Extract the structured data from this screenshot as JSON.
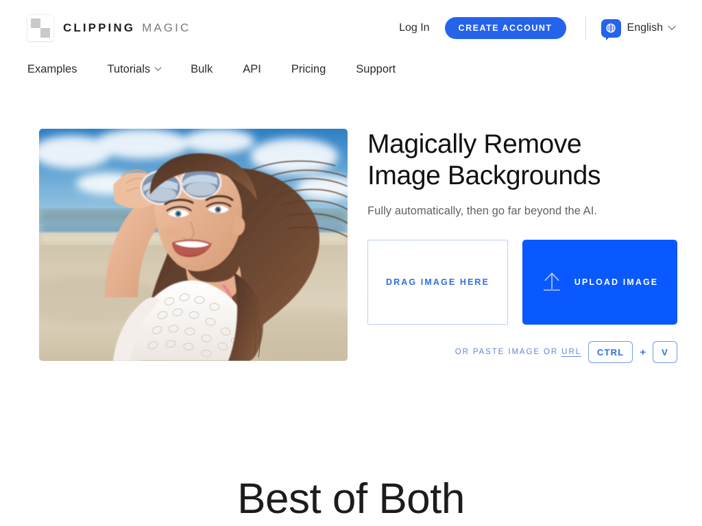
{
  "brand": {
    "word_primary": "CLIPPING",
    "word_secondary": "MAGIC",
    "logo_icon": "checkerboard-transparency-icon"
  },
  "header": {
    "login_label": "Log In",
    "create_account_label": "CREATE ACCOUNT",
    "language_label": "English",
    "language_icon": "globe-speech-bubble-icon",
    "language_chevron_icon": "chevron-down-icon",
    "accent_color": "#2563EB"
  },
  "nav": {
    "items": [
      {
        "label": "Examples",
        "has_dropdown": false
      },
      {
        "label": "Tutorials",
        "has_dropdown": true
      },
      {
        "label": "Bulk",
        "has_dropdown": false
      },
      {
        "label": "API",
        "has_dropdown": false
      },
      {
        "label": "Pricing",
        "has_dropdown": false
      },
      {
        "label": "Support",
        "has_dropdown": false
      }
    ]
  },
  "hero": {
    "photo_alt": "Smiling woman on a sunny beach holding mirrored sunglasses up on her forehead, wearing a white crochet top, hair blowing in the wind",
    "title_line1": "Magically Remove",
    "title_line2": "Image Backgrounds",
    "subtitle": "Fully automatically, then go far beyond the AI.",
    "dropzone_label": "DRAG IMAGE HERE",
    "upload_label": "UPLOAD IMAGE",
    "upload_icon": "upload-arrow-icon",
    "upload_button_color": "#0A58FF",
    "paste_text_prefix": "OR PASTE IMAGE OR",
    "paste_url_label": "URL",
    "key_ctrl": "CTRL",
    "key_plus": "+",
    "key_v": "V"
  },
  "section": {
    "heading": "Best of Both"
  }
}
